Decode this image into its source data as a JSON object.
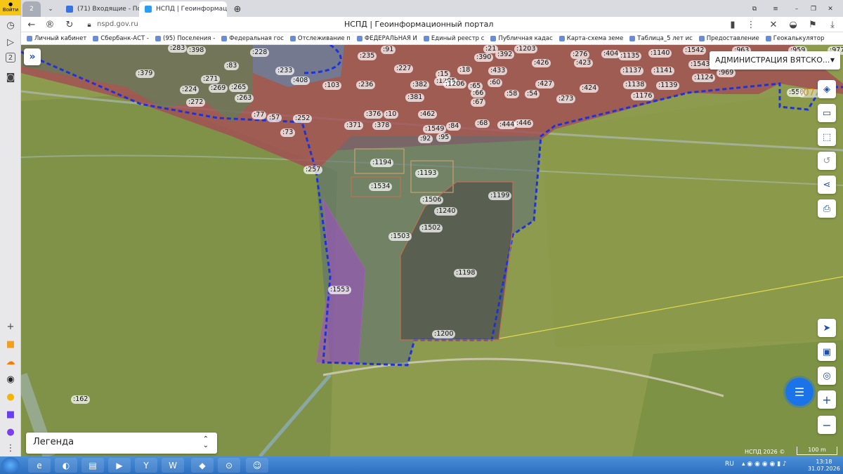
{
  "sidebar": {
    "signin_label": "Войти",
    "tab_count": "2"
  },
  "tabs": [
    {
      "label": "(71) Входящие - Почта М"
    },
    {
      "label": "НСПД | Геоинформацио"
    }
  ],
  "addressbar": {
    "url": "nspd.gov.ru",
    "page_title": "НСПД | Геоинформационный портал"
  },
  "bookmarks": [
    "Личный кабинет",
    "Сбербанк-АСТ - ",
    "(95) Поселения - ",
    "Федеральная гос",
    "Отслеживание п",
    "ФЕДЕРАЛЬНАЯ И",
    "Единый реестр с",
    "Публичная кадас",
    "Карта-схема земе",
    "Таблица_5 лет ис",
    "Предоставление",
    "Геокалькулятор"
  ],
  "map": {
    "admin_select": "АДМИНИСТРАЦИЯ ВЯТСКО...",
    "legend_label": "Легенда",
    "copyright": "НСПД 2026 ©",
    "scale_label": "100 m",
    "edge_label": ":07.0",
    "plot_labels": [
      ":283",
      ":398",
      ":228",
      ":91",
      ":235",
      ":21",
      ":392",
      ":1203",
      ":276",
      ":404",
      ":1135",
      ":1140",
      ":1542",
      ":963",
      ":959",
      ":977",
      ":379",
      ":233",
      ":83",
      ":271",
      ":408",
      ":227",
      ":390",
      ":426",
      ":423",
      ":1137",
      ":1141",
      ":1543",
      ":969",
      ":224",
      ":269",
      ":265",
      ":103",
      ":236",
      ":1205",
      ":18",
      ":433",
      ":1138",
      ":1139",
      ":1124",
      ":550",
      ":263",
      ":272",
      ":382",
      ":15",
      ":1206",
      ":60",
      ":427",
      ":424",
      ":65",
      ":66",
      ":381",
      ":58",
      ":54",
      ":273",
      ":1176",
      ":77",
      ":57",
      ":252",
      ":376",
      ":10",
      ":462",
      ":67",
      ":371",
      ":378",
      ":1549",
      ":84",
      ":68",
      ":444",
      ":446",
      ":73",
      ":92",
      ":95",
      ":257",
      ":1194",
      ":1193",
      ":1534",
      ":1199",
      ":1506",
      ":1240",
      ":1502",
      ":1503",
      ":1198",
      ":1553",
      ":1200",
      ":162"
    ]
  },
  "taskbar": {
    "lang": "RU",
    "time": "13:18",
    "date": "31.07.2026"
  }
}
